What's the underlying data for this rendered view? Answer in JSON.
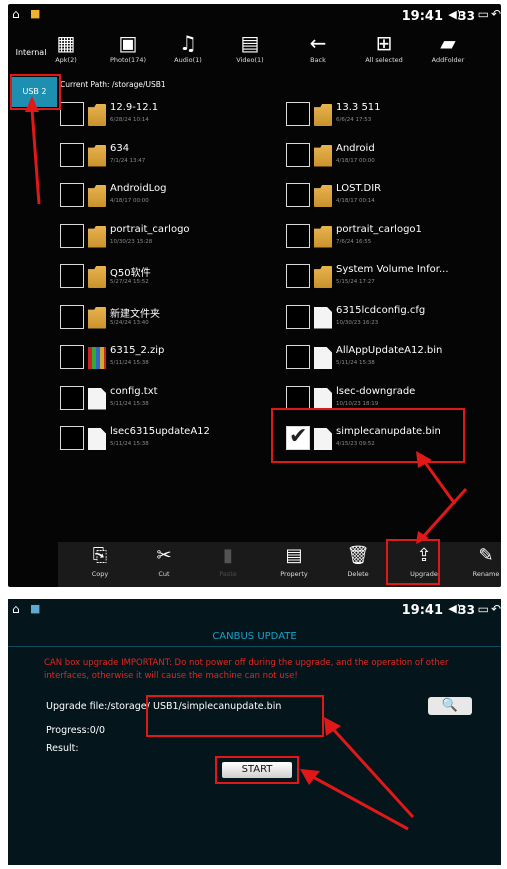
{
  "top_screen": {
    "status": {
      "time": "19:41",
      "volume": "33"
    },
    "toolbar": [
      {
        "icon": "apk-icon",
        "glyph": "▦",
        "label": "Apk(2)"
      },
      {
        "icon": "photo-icon",
        "glyph": "▣",
        "label": "Photo(174)"
      },
      {
        "icon": "audio-icon",
        "glyph": "♫",
        "label": "Audio(1)"
      },
      {
        "icon": "video-icon",
        "glyph": "▤",
        "label": "Video(1)"
      },
      {
        "icon": "back-icon",
        "glyph": "←",
        "label": "Back"
      },
      {
        "icon": "all-selected-icon",
        "glyph": "⊞",
        "label": "All selected"
      },
      {
        "icon": "add-folder-icon",
        "glyph": "▰",
        "label": "AddFolder"
      }
    ],
    "sidebar": {
      "internal_label": "Internal",
      "usb_label": "USB 2"
    },
    "current_path": "Current Path: /storage/USB1",
    "files": [
      {
        "name": "12.9-12.1",
        "date": "6/28/24 10:14",
        "type": "folder",
        "checked": false
      },
      {
        "name": "13.3 511",
        "date": "6/6/24 17:53",
        "type": "folder",
        "checked": false
      },
      {
        "name": "634",
        "date": "7/1/24 13:47",
        "type": "folder",
        "checked": false
      },
      {
        "name": "Android",
        "date": "4/18/17 00:00",
        "type": "folder",
        "checked": false
      },
      {
        "name": "AndroidLog",
        "date": "4/18/17 00:00",
        "type": "folder",
        "checked": false
      },
      {
        "name": "LOST.DIR",
        "date": "4/18/17 00:14",
        "type": "folder",
        "checked": false
      },
      {
        "name": "portrait_carlogo",
        "date": "10/30/23 15:28",
        "type": "folder",
        "checked": false
      },
      {
        "name": "portrait_carlogo1",
        "date": "7/6/24 16:55",
        "type": "folder",
        "checked": false
      },
      {
        "name": "Q50软件",
        "date": "5/27/24 15:52",
        "type": "folder",
        "checked": false
      },
      {
        "name": "System Volume Infor...",
        "date": "5/15/24 17:27",
        "type": "folder",
        "checked": false
      },
      {
        "name": "新建文件夹",
        "date": "5/24/24 13:40",
        "type": "folder",
        "checked": false
      },
      {
        "name": "6315lcdconfig.cfg",
        "date": "10/30/23 16:23",
        "type": "file",
        "checked": false
      },
      {
        "name": "6315_2.zip",
        "date": "5/11/24 15:38",
        "type": "zip",
        "checked": false
      },
      {
        "name": "AllAppUpdateA12.bin",
        "date": "5/11/24 15:38",
        "type": "file",
        "checked": false
      },
      {
        "name": "config.txt",
        "date": "5/11/24 15:38",
        "type": "file",
        "checked": false
      },
      {
        "name": "lsec-downgrade",
        "date": "10/10/23 18:19",
        "type": "file",
        "checked": false
      },
      {
        "name": "lsec6315updateA12",
        "date": "5/11/24 15:38",
        "type": "file",
        "checked": false
      },
      {
        "name": "simplecanupdate.bin",
        "date": "4/15/23 09:52",
        "type": "file",
        "checked": true
      }
    ],
    "bottom_toolbar": [
      {
        "icon": "copy-icon",
        "glyph": "⎘",
        "label": "Copy",
        "enabled": true
      },
      {
        "icon": "cut-icon",
        "glyph": "✂",
        "label": "Cut",
        "enabled": true
      },
      {
        "icon": "paste-icon",
        "glyph": "▮",
        "label": "Paste",
        "enabled": false
      },
      {
        "icon": "property-icon",
        "glyph": "▤",
        "label": "Property",
        "enabled": true
      },
      {
        "icon": "delete-icon",
        "glyph": "🗑",
        "label": "Delete",
        "enabled": true
      },
      {
        "icon": "upgrade-icon",
        "glyph": "⇪",
        "label": "Upgrade",
        "enabled": true
      },
      {
        "icon": "rename-icon",
        "glyph": "✎",
        "label": "Rename",
        "enabled": true
      }
    ]
  },
  "bottom_screen": {
    "status": {
      "time": "19:41",
      "volume": "33"
    },
    "title": "CANBUS UPDATE",
    "warning": "CAN box upgrade IMPORTANT: Do not power off during the upgrade, and the operation of other interfaces, otherwise it will cause the machine can not use!",
    "upgrade_file_label": "Upgrade file:/storage/",
    "upgrade_file_path": "USB1/simplecanupdate.bin",
    "progress": "Progress:0/0",
    "result": "Result:",
    "start_label": "START",
    "search_glyph": "🔍"
  },
  "colors": {
    "highlight": "#e01818",
    "usb_tab": "#1d8fb0",
    "title": "#1aa0c8",
    "warning": "#e3261f"
  }
}
